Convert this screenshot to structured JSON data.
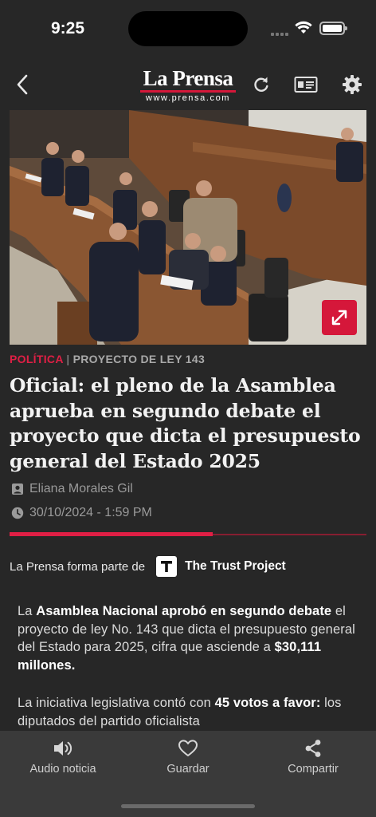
{
  "status_bar": {
    "time": "9:25"
  },
  "nav": {
    "logo_main": "La Prensa",
    "logo_sub": "www.prensa.com",
    "back_icon": "chevron-left-icon",
    "refresh_icon": "refresh-icon",
    "card_icon": "id-card-icon",
    "settings_icon": "gear-icon"
  },
  "article": {
    "section": "POLÍTICA",
    "separator": "|",
    "tag": "PROYECTO DE LEY 143",
    "headline": "Oficial: el pleno de la Asamblea aprueba en segundo debate el proyecto que dicta el presupuesto general del Estado 2025",
    "author": "Eliana Morales Gil",
    "datetime": "30/10/2024 - 1:59 PM",
    "read_progress": 0.57,
    "trust_prefix": "La Prensa forma parte de",
    "trust_name": "The Trust Project",
    "p1": {
      "t1": "La ",
      "b1": "Asamblea Nacional aprobó en segundo debate",
      "t2": " el proyecto de ley No. 143 que dicta el presupuesto general del Estado para 2025, cifra que asciende a ",
      "b2": "$30,111 millones."
    },
    "p2": {
      "t1": "La iniciativa legislativa contó con ",
      "b1": "45 votos a favor:",
      "t2": " los diputados del partido oficialista"
    }
  },
  "bottom_bar": {
    "audio_label": "Audio noticia",
    "save_label": "Guardar",
    "share_label": "Compartir"
  },
  "colors": {
    "accent": "#d5173a",
    "background": "#272727",
    "bottom_bar": "#3a3a3a"
  }
}
